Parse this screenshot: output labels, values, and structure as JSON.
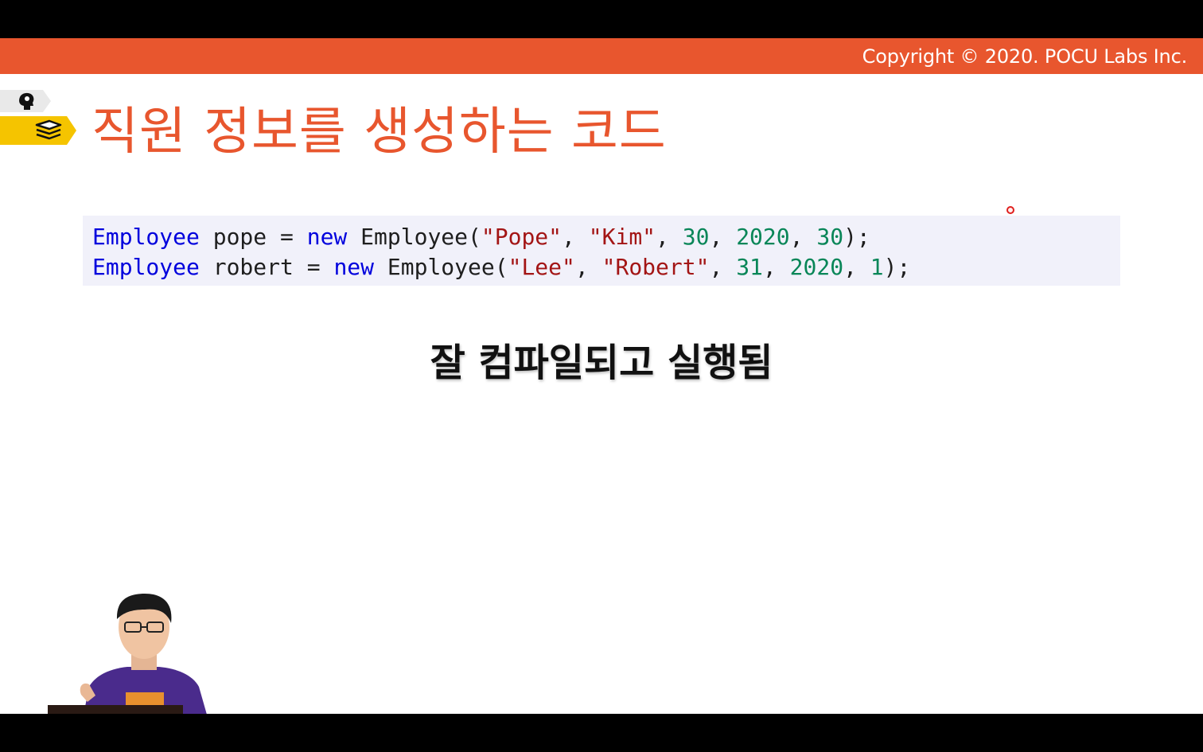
{
  "header": {
    "copyright": "Copyright © 2020. POCU Labs Inc.",
    "accent_color": "#e8562e"
  },
  "nav_tags": [
    {
      "icon": "brain-head-icon",
      "color": "#e9e9e9"
    },
    {
      "icon": "book-stack-icon",
      "color": "#f5c400"
    }
  ],
  "slide": {
    "title": "직원 정보를 생성하는 코드",
    "message": "잘 컴파일되고 실행됨"
  },
  "code": {
    "lines": [
      [
        {
          "t": "Employee",
          "c": "kw"
        },
        {
          "t": " pope = ",
          "c": "plain"
        },
        {
          "t": "new",
          "c": "kw"
        },
        {
          "t": " Employee(",
          "c": "plain"
        },
        {
          "t": "\"Pope\"",
          "c": "str"
        },
        {
          "t": ", ",
          "c": "plain"
        },
        {
          "t": "\"Kim\"",
          "c": "str"
        },
        {
          "t": ", ",
          "c": "plain"
        },
        {
          "t": "30",
          "c": "num"
        },
        {
          "t": ", ",
          "c": "plain"
        },
        {
          "t": "2020",
          "c": "num"
        },
        {
          "t": ", ",
          "c": "plain"
        },
        {
          "t": "30",
          "c": "num"
        },
        {
          "t": ");",
          "c": "plain"
        }
      ],
      [
        {
          "t": "Employee",
          "c": "kw"
        },
        {
          "t": " robert = ",
          "c": "plain"
        },
        {
          "t": "new",
          "c": "kw"
        },
        {
          "t": " Employee(",
          "c": "plain"
        },
        {
          "t": "\"Lee\"",
          "c": "str"
        },
        {
          "t": ", ",
          "c": "plain"
        },
        {
          "t": "\"Robert\"",
          "c": "str"
        },
        {
          "t": ", ",
          "c": "plain"
        },
        {
          "t": "31",
          "c": "num"
        },
        {
          "t": ", ",
          "c": "plain"
        },
        {
          "t": "2020",
          "c": "num"
        },
        {
          "t": ", ",
          "c": "plain"
        },
        {
          "t": "1",
          "c": "num"
        },
        {
          "t": ");",
          "c": "plain"
        }
      ]
    ]
  },
  "presenter": {
    "icon": "presenter-video-icon"
  }
}
